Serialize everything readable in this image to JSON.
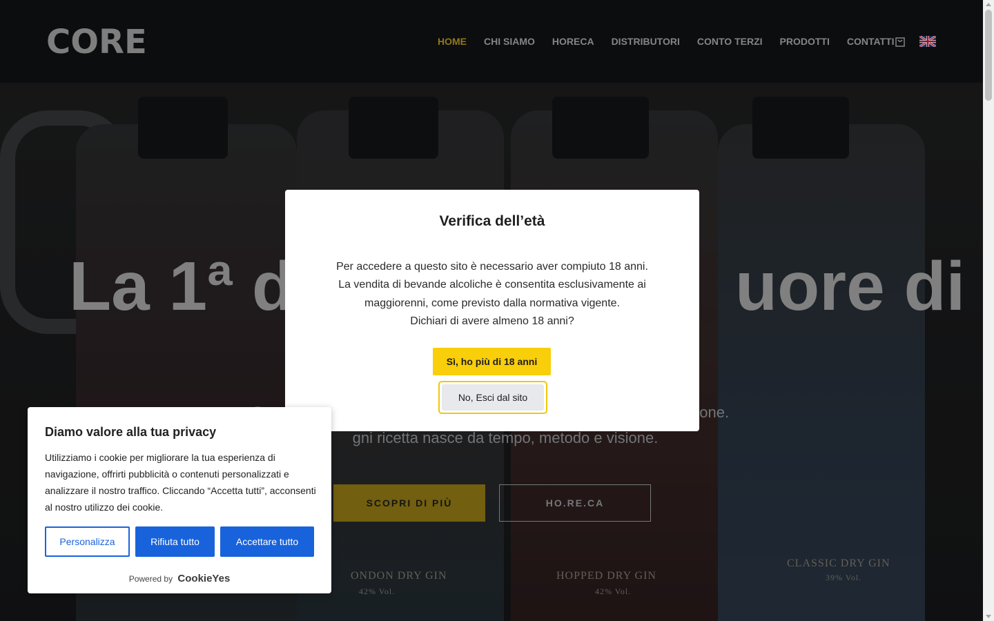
{
  "header": {
    "logo": "CORE",
    "nav": [
      "HOME",
      "CHI SIAMO",
      "HORECA",
      "DISTRIBUTORI",
      "CONTO TERZI",
      "PRODOTTI",
      "CONTATTI"
    ],
    "active_nav": "HOME",
    "accent_color": "#b39322"
  },
  "hero": {
    "headline": "La 1ª d                       uore di",
    "sub1": "D                                                                                                     rione.",
    "sub2": "gni ricetta nasce da tempo, metodo e visione.",
    "btn_discover": "SCOPRI DI PIÙ",
    "btn_horeca": "HO.RE.CA",
    "bottle_labels": [
      "ONDON DRY GIN",
      "42% Vol.",
      "HOPPED DRY GIN",
      "42% Vol.",
      "CLASSIC DRY GIN",
      "39% Vol."
    ]
  },
  "age_modal": {
    "title": "Verifica dell’età",
    "lines": [
      "Per accedere a questo sito è necessario aver compiuto 18 anni.",
      "La vendita di bevande alcoliche è consentita esclusivamente ai",
      "maggiorenni, come previsto dalla normativa vigente.",
      "Dichiari di avere almeno 18 anni?"
    ],
    "yes_label": "Sì, ho più di 18 anni",
    "no_label": "No, Esci dal sito",
    "yes_color": "#f9ce0a"
  },
  "cookie": {
    "title": "Diamo valore alla tua privacy",
    "text": "Utilizziamo i cookie per migliorare la tua esperienza di navigazione, offrirti pubblicità o contenuti personalizzati e analizzare il nostro traffico. Cliccando “Accetta tutti”, acconsenti al nostro utilizzo dei cookie.",
    "customize": "Personalizza",
    "reject": "Rifiuta tutto",
    "accept": "Accettare tutto",
    "powered_by": "Powered by",
    "brand": "CookieYes",
    "button_color": "#1863dc"
  }
}
